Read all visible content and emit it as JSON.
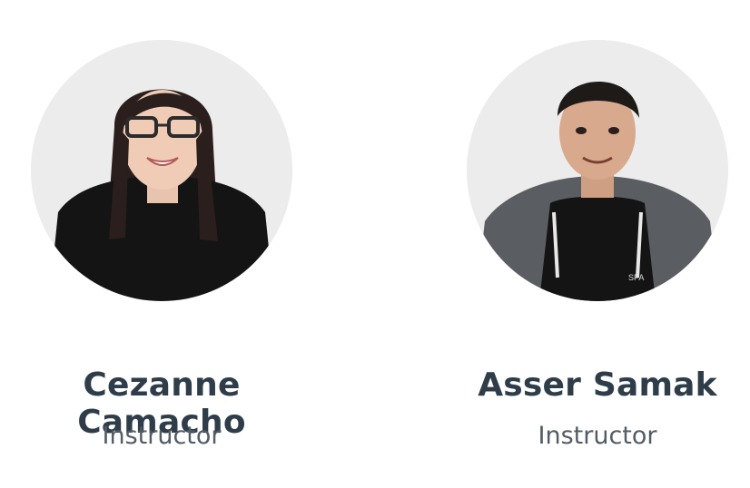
{
  "instructors": [
    {
      "name": "Cezanne Camacho",
      "role": "Instructor"
    },
    {
      "name": "Asser Samak",
      "role": "Instructor"
    }
  ],
  "shirt_text": "SPA",
  "colors": {
    "name_text": "#2e3d49",
    "role_text": "#525c65",
    "avatar_bg": "#ececec"
  }
}
